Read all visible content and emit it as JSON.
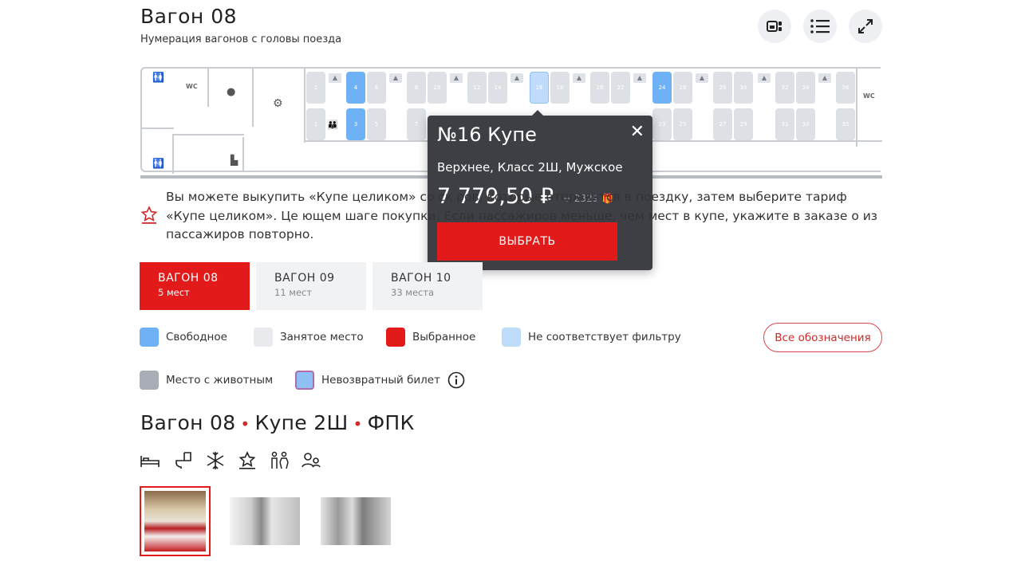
{
  "header": {
    "title": "Вагон 08",
    "subtitle": "Нумерация вагонов с головы поезда"
  },
  "car_map": {
    "labels": {
      "wc_left": "WC",
      "wc_right": "WC"
    },
    "top_seats": [
      {
        "n": "2",
        "state": "taken"
      },
      {
        "n": "4",
        "state": "free"
      },
      {
        "n": "6",
        "state": "taken"
      },
      {
        "n": "8",
        "state": "taken"
      },
      {
        "n": "10",
        "state": "taken"
      },
      {
        "n": "12",
        "state": "taken"
      },
      {
        "n": "14",
        "state": "taken"
      },
      {
        "n": "16",
        "state": "filter"
      },
      {
        "n": "18",
        "state": "taken"
      },
      {
        "n": "20",
        "state": "taken"
      },
      {
        "n": "22",
        "state": "taken"
      },
      {
        "n": "24",
        "state": "free"
      },
      {
        "n": "26",
        "state": "taken"
      },
      {
        "n": "28",
        "state": "taken"
      },
      {
        "n": "30",
        "state": "taken"
      },
      {
        "n": "32",
        "state": "taken"
      },
      {
        "n": "34",
        "state": "taken"
      },
      {
        "n": "36",
        "state": "taken"
      }
    ],
    "bottom_seats": [
      {
        "n": "1",
        "state": "taken"
      },
      {
        "n": "3",
        "state": "free"
      },
      {
        "n": "5",
        "state": "taken"
      },
      {
        "n": "7",
        "state": "taken"
      },
      {
        "n": "23",
        "state": "taken"
      },
      {
        "n": "25",
        "state": "taken"
      },
      {
        "n": "27",
        "state": "taken"
      },
      {
        "n": "29",
        "state": "taken"
      },
      {
        "n": "31",
        "state": "taken"
      },
      {
        "n": "33",
        "state": "taken"
      },
      {
        "n": "35",
        "state": "taken"
      }
    ]
  },
  "tooltip": {
    "title": "№16 Купе",
    "close": "✕",
    "description": "Верхнее, Класс 2Ш, Мужское",
    "price": "7 779,50 ₽",
    "bonus": "+ 2329",
    "button": "ВЫБРАТЬ"
  },
  "notice": {
    "text": "Вы можете выкупить «Купе целиком» со ск                                              ров, которые отправятся в поездку, затем выберите тариф «Купе целиком». Це                                                ющем шаге покупки. Если пассажиров меньше, чем мест в купе, укажите в заказе                                          о из пассажиров повторно."
  },
  "tabs": [
    {
      "label": "ВАГОН 08",
      "count": "5 мест",
      "active": true
    },
    {
      "label": "ВАГОН 09",
      "count": "11 мест",
      "active": false
    },
    {
      "label": "ВАГОН 10",
      "count": "33 места",
      "active": false
    }
  ],
  "legend": {
    "free": "Свободное",
    "taken": "Занятое место",
    "selected": "Выбранное",
    "filter": "Не соответствует фильтру",
    "pet": "Место с животным",
    "nonrefund": "Невозвратный билет",
    "all_button": "Все обозначения"
  },
  "colors": {
    "brand_red": "#e21a1a",
    "free_blue": "#6fb1f5",
    "filter_blue": "#bfdcfb",
    "taken_gray": "#dde0e4",
    "pet_gray": "#a9adb5",
    "tooltip_bg": "#3d3f45"
  },
  "section": {
    "car": "Вагон 08",
    "type": "Купе 2Ш",
    "carrier": "ФПК",
    "separator": "•"
  },
  "amenities": [
    "bed-icon",
    "toilet-icon",
    "snowflake-icon",
    "star-service-icon",
    "wc-people-icon",
    "passengers-icon"
  ],
  "photos": [
    "compartment-photo",
    "corridor-photo",
    "toilet-photo"
  ]
}
